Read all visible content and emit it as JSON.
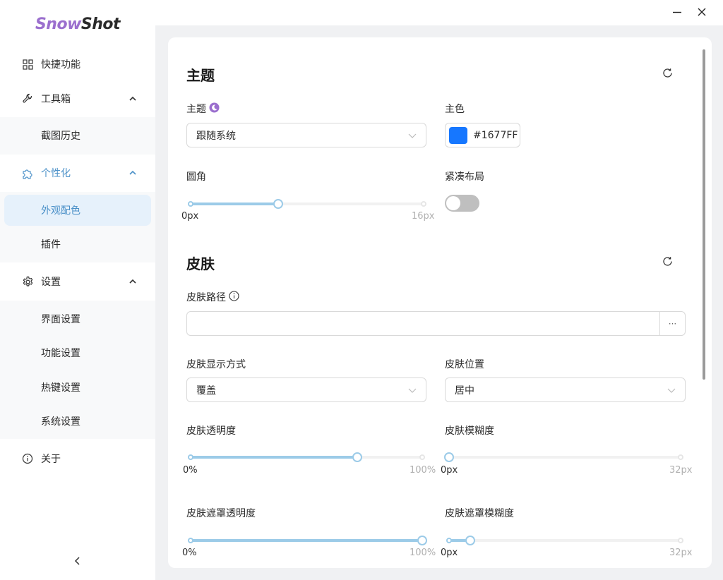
{
  "app": {
    "logo_part1": "Snow",
    "logo_part2": "Shot"
  },
  "sidebar": {
    "items": [
      {
        "label": "快捷功能",
        "icon": "grid-icon"
      },
      {
        "label": "工具箱",
        "icon": "wrench-icon",
        "expanded": true,
        "children": [
          "截图历史"
        ]
      },
      {
        "label": "个性化",
        "icon": "puzzle-icon",
        "expanded": true,
        "active": true,
        "children": [
          "外观配色",
          "插件"
        ],
        "selected_child": "外观配色"
      },
      {
        "label": "设置",
        "icon": "gear-icon",
        "expanded": true,
        "children": [
          "界面设置",
          "功能设置",
          "热键设置",
          "系统设置"
        ]
      },
      {
        "label": "关于",
        "icon": "info-icon"
      }
    ],
    "collapse_icon": "chevron-left-icon"
  },
  "window": {
    "minimize_icon": "minimize-icon",
    "close_icon": "close-icon"
  },
  "theme_section": {
    "title": "主题",
    "theme_label": "主题",
    "theme_value": "跟随系统",
    "primary_color_label": "主色",
    "primary_color_value": "#1677FF",
    "radius_label": "圆角",
    "radius_min": "0px",
    "radius_max": "16px",
    "radius_value": 6,
    "radius_range": [
      0,
      16
    ],
    "compact_label": "紧凑布局",
    "compact_on": false
  },
  "skin_section": {
    "title": "皮肤",
    "path_label": "皮肤路径",
    "path_value": "",
    "browse_label": "···",
    "display_mode_label": "皮肤显示方式",
    "display_mode_value": "覆盖",
    "position_label": "皮肤位置",
    "position_value": "居中",
    "opacity_label": "皮肤透明度",
    "opacity_min": "0%",
    "opacity_max": "100%",
    "opacity_value": 0.72,
    "blur_label": "皮肤模糊度",
    "blur_min": "0px",
    "blur_max": "32px",
    "blur_value": 0,
    "mask_opacity_label": "皮肤遮罩透明度",
    "mask_opacity_min": "0%",
    "mask_opacity_max": "100%",
    "mask_opacity_value": 1.0,
    "mask_blur_label": "皮肤遮罩模糊度",
    "mask_blur_min": "0px",
    "mask_blur_max": "32px",
    "mask_blur_value": 0.09
  },
  "colors": {
    "accent": "#4a90c8",
    "slider": "#9ccbe8",
    "primary_swatch": "#1677FF",
    "theme_icon": "#9b6fce"
  }
}
